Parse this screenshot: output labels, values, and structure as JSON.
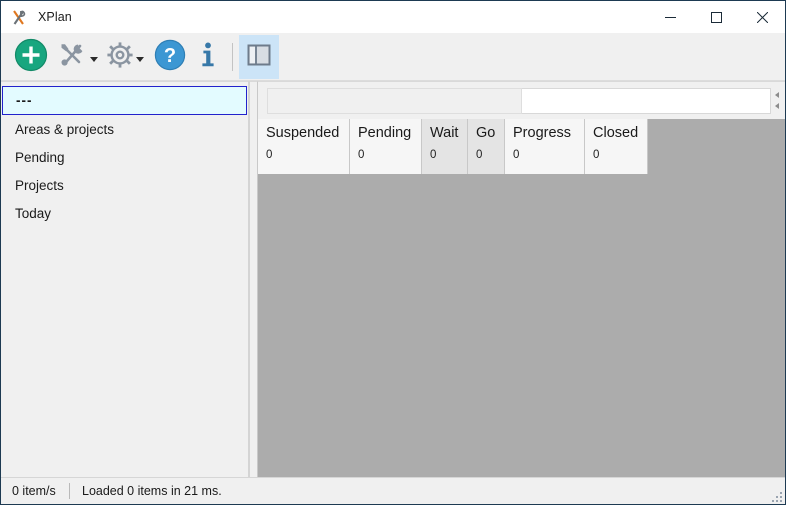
{
  "window": {
    "title": "XPlan",
    "logo_icon": "xplan-logo-icon",
    "controls": {
      "minimize_label": "Minimize",
      "maximize_label": "Maximize",
      "close_label": "Close"
    },
    "border_color": "#1d3a52"
  },
  "toolbar": {
    "buttons": [
      {
        "name": "add-button",
        "icon": "plus-circle-icon",
        "label": "Add",
        "color": "#18a67f",
        "has_dropdown": false,
        "toggled": false
      },
      {
        "name": "tools-button",
        "icon": "tools-icon",
        "label": "Tools",
        "color": "#8b95a1",
        "has_dropdown": true,
        "toggled": false
      },
      {
        "name": "settings-button",
        "icon": "gear-icon",
        "label": "Settings",
        "color": "#8b95a1",
        "has_dropdown": true,
        "toggled": false
      },
      {
        "name": "help-button",
        "icon": "question-circle-icon",
        "label": "Help",
        "color": "#3c97d3",
        "has_dropdown": false,
        "toggled": false
      },
      {
        "name": "info-button",
        "icon": "info-icon",
        "label": "Info",
        "color": "#3778a8",
        "has_dropdown": false,
        "toggled": false
      },
      {
        "name": "toggle-panel-button",
        "icon": "split-panel-icon",
        "label": "Toggle panel",
        "color": "#6e7b8b",
        "has_dropdown": false,
        "toggled": true
      }
    ],
    "toggled_background": "#cce4f7"
  },
  "sidebar": {
    "items": [
      {
        "label": "---",
        "selected": true
      },
      {
        "label": "Areas & projects",
        "selected": false
      },
      {
        "label": "Pending",
        "selected": false
      },
      {
        "label": "Projects",
        "selected": false
      },
      {
        "label": "Today",
        "selected": false
      }
    ],
    "selection_background": "#e3fbff",
    "selection_border": "#2222cc"
  },
  "filter_bar": {
    "left_field": {
      "value": "",
      "placeholder": ""
    },
    "right_field": {
      "value": "",
      "placeholder": ""
    },
    "spinner_up_icon": "spinner-up-icon",
    "spinner_down_icon": "spinner-down-icon"
  },
  "grid": {
    "columns": [
      {
        "title": "Suspended",
        "count": "0",
        "width": 92,
        "shaded": false
      },
      {
        "title": "Pending",
        "count": "0",
        "width": 72,
        "shaded": false
      },
      {
        "title": "Wait",
        "count": "0",
        "width": 46,
        "shaded": true
      },
      {
        "title": "Go",
        "count": "0",
        "width": 37,
        "shaded": true
      },
      {
        "title": "Progress",
        "count": "0",
        "width": 80,
        "shaded": false
      },
      {
        "title": "Closed",
        "count": "0",
        "width": 63,
        "shaded": false
      }
    ],
    "empty_background": "#acacac",
    "rows": []
  },
  "statusbar": {
    "item_rate": "0 item/s",
    "load_message": "Loaded 0 items in 21 ms.",
    "resize_grip_icon": "resize-grip-icon"
  }
}
